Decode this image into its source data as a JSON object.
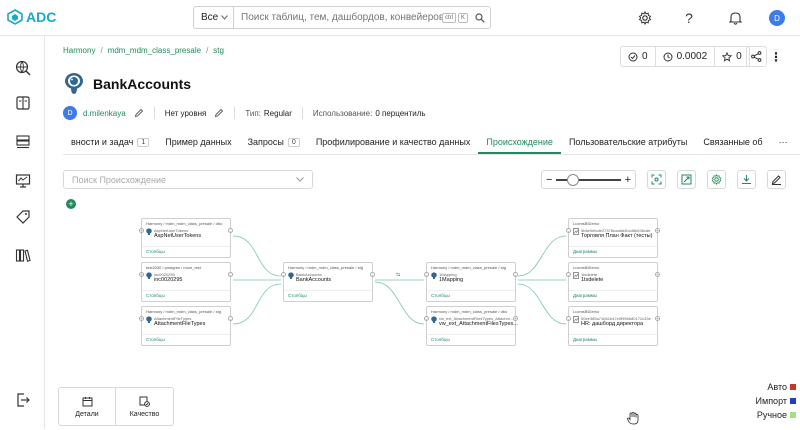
{
  "app": {
    "logo": "ADC"
  },
  "search": {
    "scope": "Все",
    "placeholder": "Поиск таблиц, тем, дашбордов, конвейеров, м...",
    "kbd1": "ctrl",
    "kbd2": "K"
  },
  "user": {
    "initial": "D"
  },
  "breadcrumb": [
    "Harmony",
    "mdm_mdm_class_presale",
    "stg"
  ],
  "stats": {
    "tests": "0",
    "freshness": "0.0002",
    "stars": "0"
  },
  "entity": {
    "title": "BankAccounts",
    "owner_initial": "D",
    "owner": "d.milenkaya",
    "tier": "Нет уровня",
    "type_label": "Тип:",
    "type_value": "Regular",
    "usage_label": "Использование:",
    "usage_value": "0 перцентиль"
  },
  "tabs": [
    {
      "label": "вности и задач",
      "badge": "1"
    },
    {
      "label": "Пример данных"
    },
    {
      "label": "Запросы",
      "badge": "0"
    },
    {
      "label": "Профилирование и качество данных"
    },
    {
      "label": "Происхождение"
    },
    {
      "label": "Пользовательские атрибуты"
    },
    {
      "label": "Связанные об"
    },
    {
      "label": "···"
    }
  ],
  "lineage": {
    "search_placeholder": "Поиск Происхождение",
    "nodes": [
      {
        "path": "Harmony / mdm_mdm_class_presale / dbo",
        "sub": "AspNetUserTokens",
        "name": "AspNetUserTokens",
        "cols": "Столбцы"
      },
      {
        "path": "test2030 / postgres / mom_test",
        "sub": "inc0020295",
        "name": "inc0020295",
        "cols": "Столбцы"
      },
      {
        "path": "Harmony / mdm_mdm_class_presale / stg",
        "sub": "AttachmentFileTypes",
        "name": "AttachmentFileTypes",
        "cols": "Столбцы"
      },
      {
        "path": "Harmony / mdm_mdm_class_presale / stg",
        "sub": "BankAccounts",
        "name": "BankAccounts",
        "cols": "Столбцы"
      },
      {
        "path": "Harmony / mdm_mdm_class_presale / stg",
        "sub": "1Mapping",
        "name": "1Mapping",
        "cols": "Столбцы"
      },
      {
        "path": "Harmony / mdm_mdm_class_presale / dbo",
        "sub": "vw_ext_AttachmentFilesTypes_Attachm...",
        "name": "vw_ext_AttachmentFilesTypes...",
        "cols": "Столбцы"
      },
      {
        "path": "LuxmsBIDemo",
        "sub": "5b6e0efcde27376eaa6d4bcd6b63bcde",
        "name": "Торговля План Факт (тесты)",
        "cols": "Диаграммы"
      },
      {
        "path": "LuxmsBIDemo",
        "sub": "1tsdelete",
        "name": "1tsdelete",
        "cols": "Диаграммы"
      },
      {
        "path": "LuxmsBIDemo",
        "sub": "50ee385a71b61b47e0f95b6d0172c33e",
        "name": "HR: дашборд директора",
        "cols": "Диаграммы"
      }
    ]
  },
  "panel": {
    "details": "Детали",
    "quality": "Качество"
  },
  "legend": [
    {
      "label": "Авто",
      "color": "#c0392b"
    },
    {
      "label": "Импорт",
      "color": "#1f3fbf"
    },
    {
      "label": "Ручное",
      "color": "#9ee37d"
    }
  ],
  "colors": {
    "accent": "#1f8a5b",
    "brand": "#19a9c9"
  }
}
